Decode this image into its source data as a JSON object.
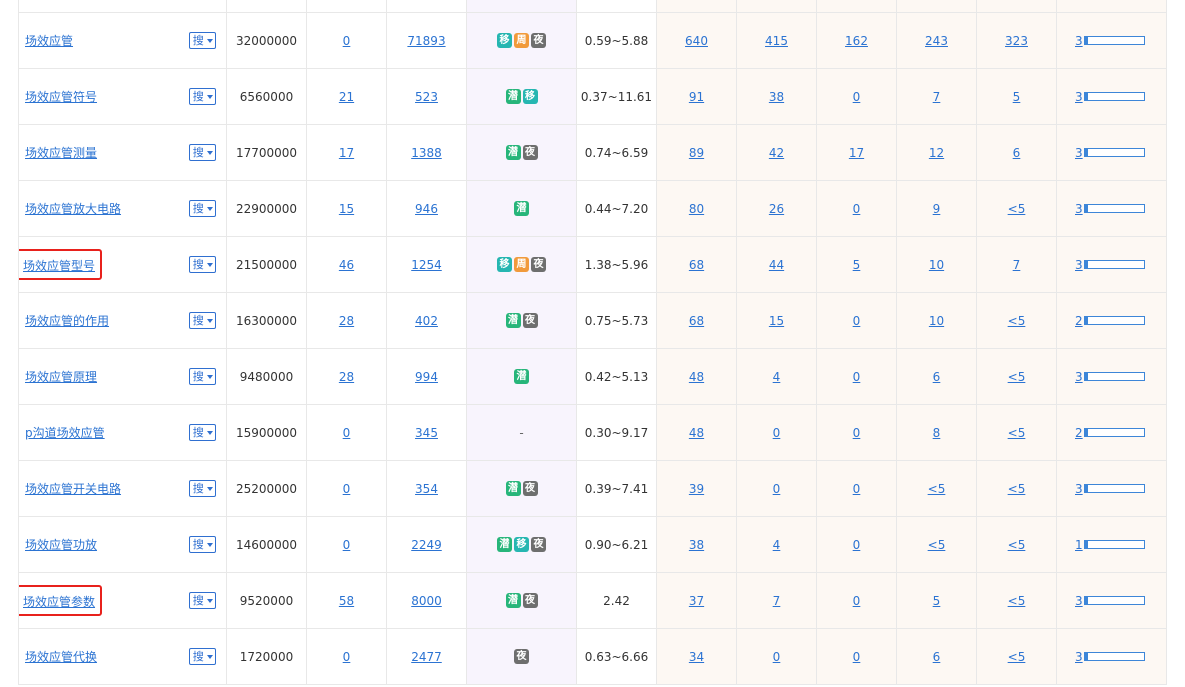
{
  "search_button_label": "搜",
  "badges": {
    "yi": "移",
    "zhou": "周",
    "ye": "夜",
    "qian": "潜"
  },
  "rows": [
    {
      "kw": "场效应管",
      "index": "32000000",
      "c1": "0",
      "c2": "71893",
      "tags": [
        "yi",
        "zhou",
        "ye"
      ],
      "price": "0.59~5.88",
      "n1": "640",
      "n2": "415",
      "n3": "162",
      "n4": "243",
      "n5": "323",
      "level": "3",
      "fill": 0.05,
      "highlight": false
    },
    {
      "kw": "场效应管符号",
      "index": "6560000",
      "c1": "21",
      "c2": "523",
      "tags": [
        "qian",
        "yi"
      ],
      "price": "0.37~11.61",
      "n1": "91",
      "n2": "38",
      "n3": "0",
      "n4": "7",
      "n5": "5",
      "level": "3",
      "fill": 0.05,
      "highlight": false
    },
    {
      "kw": "场效应管测量",
      "index": "17700000",
      "c1": "17",
      "c2": "1388",
      "tags": [
        "qian",
        "ye"
      ],
      "price": "0.74~6.59",
      "n1": "89",
      "n2": "42",
      "n3": "17",
      "n4": "12",
      "n5": "6",
      "level": "3",
      "fill": 0.05,
      "highlight": false
    },
    {
      "kw": "场效应管放大电路",
      "index": "22900000",
      "c1": "15",
      "c2": "946",
      "tags": [
        "qian"
      ],
      "price": "0.44~7.20",
      "n1": "80",
      "n2": "26",
      "n3": "0",
      "n4": "9",
      "n5": "<5",
      "level": "3",
      "fill": 0.05,
      "highlight": false
    },
    {
      "kw": "场效应管型号",
      "index": "21500000",
      "c1": "46",
      "c2": "1254",
      "tags": [
        "yi",
        "zhou",
        "ye"
      ],
      "price": "1.38~5.96",
      "n1": "68",
      "n2": "44",
      "n3": "5",
      "n4": "10",
      "n5": "7",
      "level": "3",
      "fill": 0.05,
      "highlight": true
    },
    {
      "kw": "场效应管的作用",
      "index": "16300000",
      "c1": "28",
      "c2": "402",
      "tags": [
        "qian",
        "ye"
      ],
      "price": "0.75~5.73",
      "n1": "68",
      "n2": "15",
      "n3": "0",
      "n4": "10",
      "n5": "<5",
      "level": "2",
      "fill": 0.05,
      "highlight": false
    },
    {
      "kw": "场效应管原理",
      "index": "9480000",
      "c1": "28",
      "c2": "994",
      "tags": [
        "qian"
      ],
      "price": "0.42~5.13",
      "n1": "48",
      "n2": "4",
      "n3": "0",
      "n4": "6",
      "n5": "<5",
      "level": "3",
      "fill": 0.05,
      "highlight": false
    },
    {
      "kw": "p沟道场效应管",
      "index": "15900000",
      "c1": "0",
      "c2": "345",
      "tags": [],
      "price": "0.30~9.17",
      "n1": "48",
      "n2": "0",
      "n3": "0",
      "n4": "8",
      "n5": "<5",
      "level": "2",
      "fill": 0.05,
      "highlight": false
    },
    {
      "kw": "场效应管开关电路",
      "index": "25200000",
      "c1": "0",
      "c2": "354",
      "tags": [
        "qian",
        "ye"
      ],
      "price": "0.39~7.41",
      "n1": "39",
      "n2": "0",
      "n3": "0",
      "n4": "<5",
      "n5": "<5",
      "level": "3",
      "fill": 0.05,
      "highlight": false
    },
    {
      "kw": "场效应管功放",
      "index": "14600000",
      "c1": "0",
      "c2": "2249",
      "tags": [
        "qian",
        "yi",
        "ye"
      ],
      "price": "0.90~6.21",
      "n1": "38",
      "n2": "4",
      "n3": "0",
      "n4": "<5",
      "n5": "<5",
      "level": "1",
      "fill": 0.05,
      "highlight": false
    },
    {
      "kw": "场效应管参数",
      "index": "9520000",
      "c1": "58",
      "c2": "8000",
      "tags": [
        "qian",
        "ye"
      ],
      "price": "2.42",
      "n1": "37",
      "n2": "7",
      "n3": "0",
      "n4": "5",
      "n5": "<5",
      "level": "3",
      "fill": 0.05,
      "highlight": true
    },
    {
      "kw": "场效应管代换",
      "index": "1720000",
      "c1": "0",
      "c2": "2477",
      "tags": [
        "ye"
      ],
      "price": "0.63~6.66",
      "n1": "34",
      "n2": "0",
      "n3": "0",
      "n4": "6",
      "n5": "<5",
      "level": "3",
      "fill": 0.05,
      "highlight": false
    }
  ],
  "empty_tag_text": "-"
}
